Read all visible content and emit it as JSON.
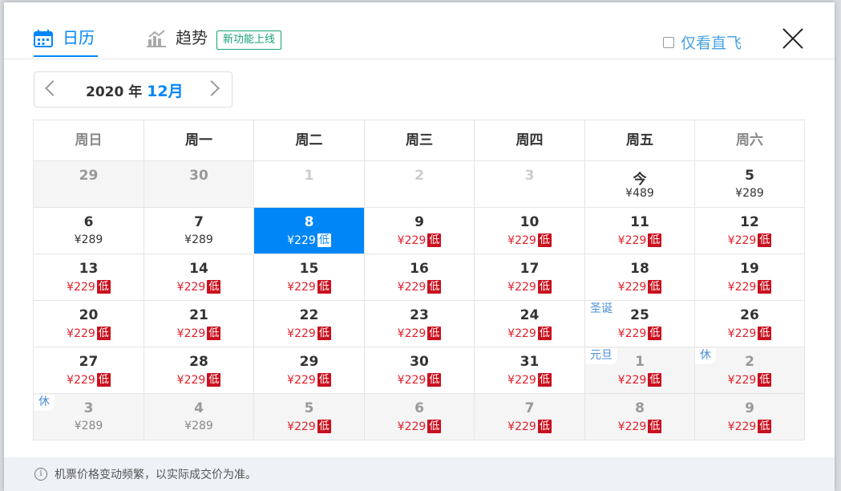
{
  "tabs": [
    {
      "label": "日历",
      "icon": "calendar-icon",
      "active": true
    },
    {
      "label": "趋势",
      "icon": "trend-chart-icon",
      "active": false
    }
  ],
  "new_feature_badge": "新功能上线",
  "direct_only_label": "仅看直飞",
  "month_nav": {
    "year": "2020",
    "year_suffix": "年",
    "month": "12月"
  },
  "weekdays": [
    "周日",
    "周一",
    "周二",
    "周三",
    "周四",
    "周五",
    "周六"
  ],
  "weeks": [
    [
      {
        "day": "29",
        "price": "",
        "state": "out"
      },
      {
        "day": "30",
        "price": "",
        "state": "out"
      },
      {
        "day": "1",
        "price": "",
        "state": "empty"
      },
      {
        "day": "2",
        "price": "",
        "state": "empty"
      },
      {
        "day": "3",
        "price": "",
        "state": "empty"
      },
      {
        "day": "今",
        "price": "¥489",
        "state": "normal"
      },
      {
        "day": "5",
        "price": "¥289",
        "state": "normal"
      }
    ],
    [
      {
        "day": "6",
        "price": "¥289",
        "state": "normal"
      },
      {
        "day": "7",
        "price": "¥289",
        "state": "normal"
      },
      {
        "day": "8",
        "price": "¥229",
        "state": "selected",
        "tag": "低"
      },
      {
        "day": "9",
        "price": "¥229",
        "state": "low",
        "tag": "低"
      },
      {
        "day": "10",
        "price": "¥229",
        "state": "low",
        "tag": "低"
      },
      {
        "day": "11",
        "price": "¥229",
        "state": "low",
        "tag": "低"
      },
      {
        "day": "12",
        "price": "¥229",
        "state": "low",
        "tag": "低"
      }
    ],
    [
      {
        "day": "13",
        "price": "¥229",
        "state": "low",
        "tag": "低"
      },
      {
        "day": "14",
        "price": "¥229",
        "state": "low",
        "tag": "低"
      },
      {
        "day": "15",
        "price": "¥229",
        "state": "low",
        "tag": "低"
      },
      {
        "day": "16",
        "price": "¥229",
        "state": "low",
        "tag": "低"
      },
      {
        "day": "17",
        "price": "¥229",
        "state": "low",
        "tag": "低"
      },
      {
        "day": "18",
        "price": "¥229",
        "state": "low",
        "tag": "低"
      },
      {
        "day": "19",
        "price": "¥229",
        "state": "low",
        "tag": "低"
      }
    ],
    [
      {
        "day": "20",
        "price": "¥229",
        "state": "low",
        "tag": "低"
      },
      {
        "day": "21",
        "price": "¥229",
        "state": "low",
        "tag": "低"
      },
      {
        "day": "22",
        "price": "¥229",
        "state": "low",
        "tag": "低"
      },
      {
        "day": "23",
        "price": "¥229",
        "state": "low",
        "tag": "低"
      },
      {
        "day": "24",
        "price": "¥229",
        "state": "low",
        "tag": "低"
      },
      {
        "day": "25",
        "price": "¥229",
        "state": "low",
        "tag": "低",
        "holiday": "圣诞"
      },
      {
        "day": "26",
        "price": "¥229",
        "state": "low",
        "tag": "低"
      }
    ],
    [
      {
        "day": "27",
        "price": "¥229",
        "state": "low",
        "tag": "低"
      },
      {
        "day": "28",
        "price": "¥229",
        "state": "low",
        "tag": "低"
      },
      {
        "day": "29",
        "price": "¥229",
        "state": "low",
        "tag": "低"
      },
      {
        "day": "30",
        "price": "¥229",
        "state": "low",
        "tag": "低"
      },
      {
        "day": "31",
        "price": "¥229",
        "state": "low",
        "tag": "低"
      },
      {
        "day": "1",
        "price": "¥229",
        "state": "out-low",
        "tag": "低",
        "holiday": "元旦"
      },
      {
        "day": "2",
        "price": "¥229",
        "state": "out-low",
        "tag": "低",
        "holiday": "休"
      }
    ],
    [
      {
        "day": "3",
        "price": "¥289",
        "state": "out",
        "holiday": "休"
      },
      {
        "day": "4",
        "price": "¥289",
        "state": "out"
      },
      {
        "day": "5",
        "price": "¥229",
        "state": "out-low",
        "tag": "低"
      },
      {
        "day": "6",
        "price": "¥229",
        "state": "out-low",
        "tag": "低"
      },
      {
        "day": "7",
        "price": "¥229",
        "state": "out-low",
        "tag": "低"
      },
      {
        "day": "8",
        "price": "¥229",
        "state": "out-low",
        "tag": "低"
      },
      {
        "day": "9",
        "price": "¥229",
        "state": "out-low",
        "tag": "低"
      }
    ]
  ],
  "footer_note": "机票价格变动频繁，以实际成交价为准。",
  "colors": {
    "accent": "#0086f6",
    "low_price": "#e0202c",
    "low_tag_bg": "#c9101e",
    "badge_green": "#18a07a"
  }
}
